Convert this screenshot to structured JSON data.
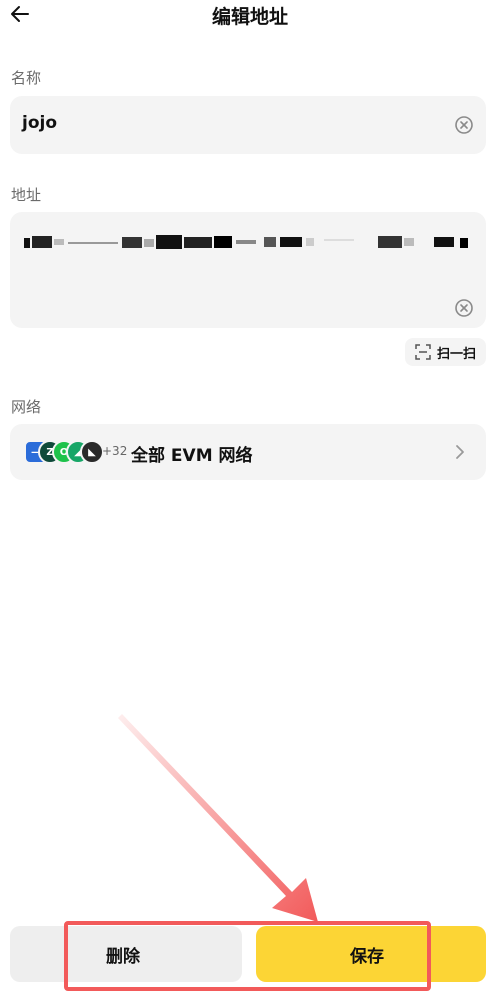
{
  "header": {
    "title": "编辑地址",
    "back_icon": "arrow-left-icon"
  },
  "name_section": {
    "label": "名称",
    "value": "jojo",
    "clear_icon": "clear-circle-icon"
  },
  "address_section": {
    "label": "地址",
    "value_redacted": true,
    "clear_icon": "clear-circle-icon"
  },
  "scan": {
    "label": "扫一扫",
    "icon": "scan-frame-icon"
  },
  "network_section": {
    "label": "网络",
    "chain_icons": [
      "ethereum-icon",
      "zksync-icon",
      "chain-green-icon",
      "chain-teal-icon",
      "chain-dark-icon"
    ],
    "more_count": "+32",
    "value": "全部 EVM 网络",
    "chevron_icon": "chevron-right-icon"
  },
  "footer": {
    "delete_label": "删除",
    "save_label": "保存"
  },
  "colors": {
    "accent": "#fcd535",
    "annotation": "#f25a5a",
    "field_bg": "#f4f4f4"
  }
}
